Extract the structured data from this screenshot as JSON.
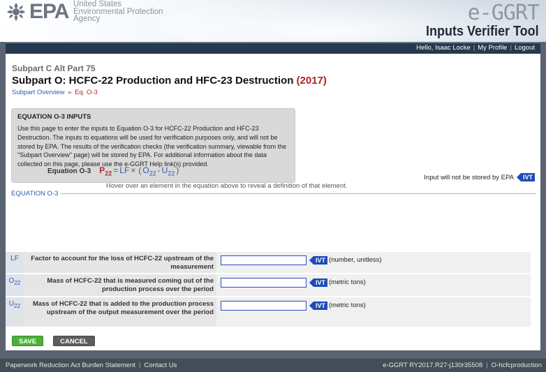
{
  "header": {
    "logo_text": "EPA",
    "agency_lines": [
      "United States",
      "Environmental Protection",
      "Agency"
    ],
    "app_name": "e-GGRT",
    "app_subtitle": "Inputs Verifier Tool"
  },
  "userbar": {
    "greeting": "Hello, Isaac Locke",
    "my_profile": "My Profile",
    "logout": "Logout"
  },
  "page": {
    "subpart_crumb": "Subpart C Alt Part 75",
    "title": "Subpart O: HCFC-22 Production and HFC-23 Destruction",
    "year": "(2017)",
    "breadcrumb": {
      "overview": "Subpart Overview",
      "separator": "»",
      "current": "Eq. O-3"
    }
  },
  "infobox": {
    "heading": "EQUATION O-3 INPUTS",
    "body": "Use this page to enter the inputs to Equation O-3 for HCFC-22 Production and HFC-23 Destruction. The inputs to equations will be used for verification purposes only, and will not be stored by EPA. The results of the verification checks (the verification summary, viewable from the \"Subpart Overview\" page) will be stored by EPA. For additional information about the data collected on this page, please use the e-GGRT Help link(s) provided."
  },
  "not_stored_notice": "Input will not be stored by EPA",
  "ivt_label": "IVT",
  "equation": {
    "legend": "EQUATION O-3",
    "label": "Equation O-3",
    "P": "P",
    "P_sub": "22",
    "eq": "=",
    "LF": "LF",
    "times": "×",
    "open": "(",
    "O": "O",
    "O_sub": "22",
    "minus": "-",
    "U": "U",
    "U_sub": "22",
    "close": ")",
    "hint": "Hover over an element in the equation above to reveal a definition of that element."
  },
  "inputs": [
    {
      "var": "LF",
      "sub": "",
      "desc": "Factor to account for the loss of HCFC-22 upstream of the measurement",
      "value": "",
      "unit": "(number, unitless)"
    },
    {
      "var": "O",
      "sub": "22",
      "desc": "Mass of HCFC-22 that is measured coming out of the production process over the period",
      "value": "",
      "unit": "(metric tons)"
    },
    {
      "var": "U",
      "sub": "22",
      "desc": "Mass of HCFC-22 that is added to the production process upstream of the output measurement over the period",
      "value": "",
      "unit": "(metric tons)"
    }
  ],
  "buttons": {
    "save": "SAVE",
    "cancel": "CANCEL"
  },
  "footer": {
    "paperwork": "Paperwork Reduction Act Burden Statement",
    "contact": "Contact Us",
    "version": "e-GGRT RY2017.R27-j130r35508",
    "server": "O-hcfcproduction"
  },
  "colors": {
    "accent_blue": "#1e4bb8",
    "year_red": "#b32222",
    "save_green": "#4caf3a"
  }
}
